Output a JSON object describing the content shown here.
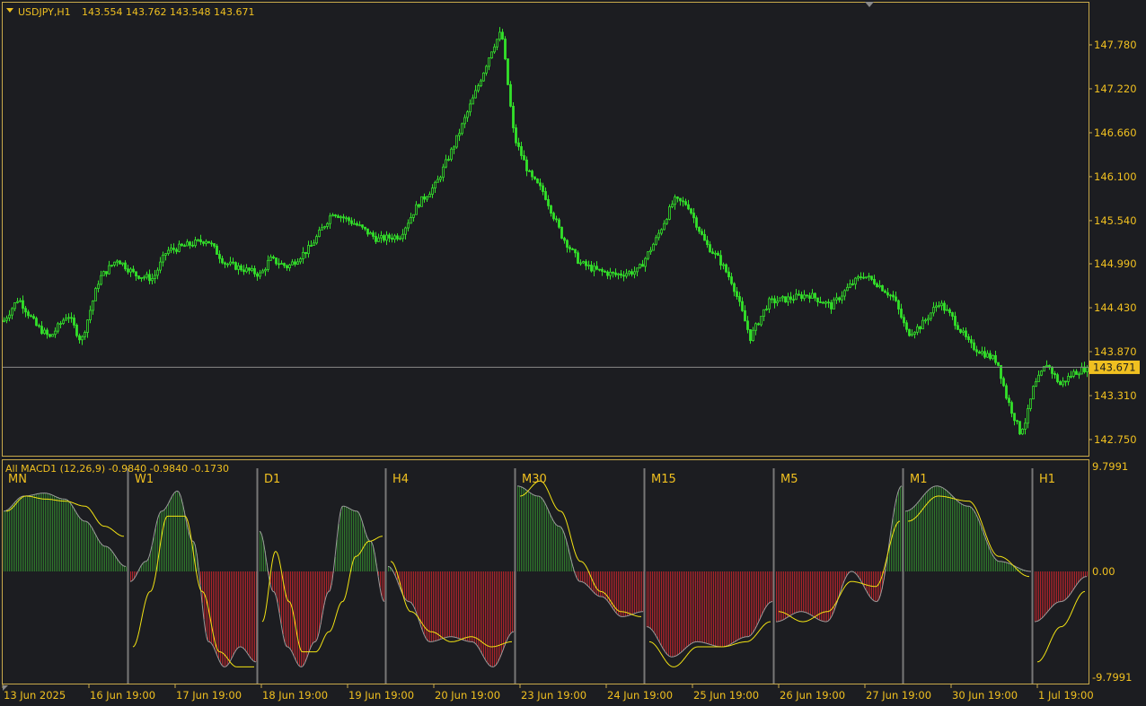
{
  "header": {
    "symbol": "USDJPY,H1",
    "ohlc": "143.554 143.762 143.548 143.671"
  },
  "price_axis": {
    "labels": [
      "147.780",
      "147.220",
      "146.660",
      "146.100",
      "145.540",
      "144.990",
      "144.430",
      "143.870",
      "143.310",
      "142.750"
    ],
    "current_price": "143.671"
  },
  "indicator": {
    "title": "All MACD1 (12,26,9) -0.9840 -0.9840 -0.1730",
    "axis_labels": [
      "9.7991",
      "0.00",
      "-9.7991"
    ],
    "timeframes": [
      "MN",
      "W1",
      "D1",
      "H4",
      "M30",
      "M15",
      "M5",
      "M1",
      "H1"
    ]
  },
  "time_axis": {
    "labels": [
      "13 Jun 2025",
      "16 Jun 19:00",
      "17 Jun 19:00",
      "18 Jun 19:00",
      "19 Jun 19:00",
      "20 Jun 19:00",
      "23 Jun 19:00",
      "24 Jun 19:00",
      "25 Jun 19:00",
      "26 Jun 19:00",
      "27 Jun 19:00",
      "30 Jun 19:00",
      "1 Jul 19:00"
    ]
  },
  "colors": {
    "background": "#1c1d21",
    "frame": "#c8a94a",
    "text": "#f0c020",
    "candle": "#33e22a",
    "hist_positive": "#2f7a2c",
    "hist_negative": "#b0232a",
    "signal": "#f2e213",
    "macd_line": "#9a9a9a",
    "separator": "#777777"
  },
  "chart_data": [
    {
      "type": "candlestick",
      "title": "USDJPY,H1",
      "ylim": [
        142.55,
        148.15
      ],
      "close_anchors": [
        [
          0,
          144.2
        ],
        [
          20,
          144.55
        ],
        [
          40,
          144.2
        ],
        [
          55,
          144.05
        ],
        [
          75,
          144.35
        ],
        [
          90,
          144.0
        ],
        [
          110,
          144.8
        ],
        [
          130,
          145.05
        ],
        [
          150,
          144.85
        ],
        [
          170,
          144.8
        ],
        [
          185,
          145.15
        ],
        [
          200,
          145.2
        ],
        [
          230,
          145.3
        ],
        [
          250,
          145.0
        ],
        [
          290,
          144.85
        ],
        [
          300,
          145.05
        ],
        [
          320,
          144.95
        ],
        [
          345,
          145.2
        ],
        [
          370,
          145.65
        ],
        [
          395,
          145.5
        ],
        [
          420,
          145.3
        ],
        [
          445,
          145.35
        ],
        [
          465,
          145.75
        ],
        [
          485,
          146.0
        ],
        [
          505,
          146.5
        ],
        [
          530,
          147.2
        ],
        [
          548,
          147.75
        ],
        [
          558,
          147.95
        ],
        [
          572,
          146.6
        ],
        [
          590,
          146.1
        ],
        [
          605,
          145.9
        ],
        [
          625,
          145.35
        ],
        [
          645,
          145.0
        ],
        [
          665,
          144.9
        ],
        [
          685,
          144.85
        ],
        [
          710,
          144.9
        ],
        [
          730,
          145.3
        ],
        [
          750,
          145.8
        ],
        [
          765,
          145.75
        ],
        [
          785,
          145.25
        ],
        [
          800,
          145.05
        ],
        [
          815,
          144.75
        ],
        [
          835,
          144.05
        ],
        [
          855,
          144.5
        ],
        [
          880,
          144.55
        ],
        [
          900,
          144.6
        ],
        [
          925,
          144.45
        ],
        [
          945,
          144.7
        ],
        [
          960,
          144.85
        ],
        [
          975,
          144.75
        ],
        [
          995,
          144.55
        ],
        [
          1010,
          144.1
        ],
        [
          1025,
          144.2
        ],
        [
          1045,
          144.5
        ],
        [
          1060,
          144.3
        ],
        [
          1080,
          143.95
        ],
        [
          1095,
          143.85
        ],
        [
          1110,
          143.75
        ],
        [
          1120,
          143.3
        ],
        [
          1135,
          142.85
        ],
        [
          1142,
          143.0
        ],
        [
          1150,
          143.4
        ],
        [
          1165,
          143.72
        ],
        [
          1180,
          143.45
        ],
        [
          1195,
          143.6
        ],
        [
          1210,
          143.67
        ]
      ],
      "last_close": 143.671
    },
    {
      "type": "line",
      "title": "All MACD1 (12,26,9)",
      "ylim": [
        -9.7991,
        9.7991
      ],
      "panels": [
        {
          "name": "MN",
          "macd": [
            0.6,
            0.75,
            0.78,
            0.72,
            0.5,
            0.25,
            0.05
          ],
          "signal": [
            0.6,
            0.75,
            0.72,
            0.7,
            0.65,
            0.45,
            0.35
          ]
        },
        {
          "name": "W1",
          "macd": [
            -0.1,
            0.1,
            0.6,
            0.8,
            0.3,
            -0.7,
            -0.95,
            -0.75,
            -0.9
          ],
          "signal": [
            -0.75,
            -0.2,
            0.55,
            0.55,
            -0.2,
            -0.8,
            -0.95,
            -0.95
          ]
        },
        {
          "name": "D1",
          "macd": [
            0.4,
            -0.2,
            -0.75,
            -0.95,
            -0.7,
            -0.2,
            0.65,
            0.6,
            0.3,
            -0.3
          ],
          "signal": [
            -0.5,
            0.2,
            -0.3,
            -0.8,
            -0.8,
            -0.6,
            -0.3,
            0.15,
            0.3,
            0.35
          ]
        },
        {
          "name": "H4",
          "macd": [
            0.05,
            -0.3,
            -0.7,
            -0.65,
            -0.7,
            -0.95,
            -0.6
          ],
          "signal": [
            0.1,
            -0.4,
            -0.6,
            -0.7,
            -0.65,
            -0.75,
            -0.7
          ]
        },
        {
          "name": "M30",
          "macd": [
            0.85,
            0.75,
            0.45,
            -0.1,
            -0.25,
            -0.45,
            -0.4
          ],
          "signal": [
            0.75,
            0.9,
            0.6,
            0.1,
            -0.2,
            -0.4,
            -0.45
          ]
        },
        {
          "name": "M15",
          "macd": [
            -0.55,
            -0.85,
            -0.7,
            -0.75,
            -0.65,
            -0.3
          ],
          "signal": [
            -0.7,
            -0.95,
            -0.75,
            -0.75,
            -0.7,
            -0.5
          ]
        },
        {
          "name": "M5",
          "macd": [
            -0.5,
            -0.4,
            -0.5,
            0.0,
            -0.3,
            0.85
          ],
          "signal": [
            -0.4,
            -0.5,
            -0.4,
            -0.1,
            -0.15,
            0.5
          ]
        },
        {
          "name": "M1",
          "macd": [
            0.6,
            0.85,
            0.65,
            0.1,
            0.0
          ],
          "signal": [
            0.5,
            0.75,
            0.7,
            0.15,
            -0.05
          ]
        },
        {
          "name": "H1",
          "macd": [
            -0.5,
            -0.3,
            -0.05
          ],
          "signal": [
            -0.9,
            -0.55,
            -0.2
          ]
        }
      ]
    }
  ]
}
